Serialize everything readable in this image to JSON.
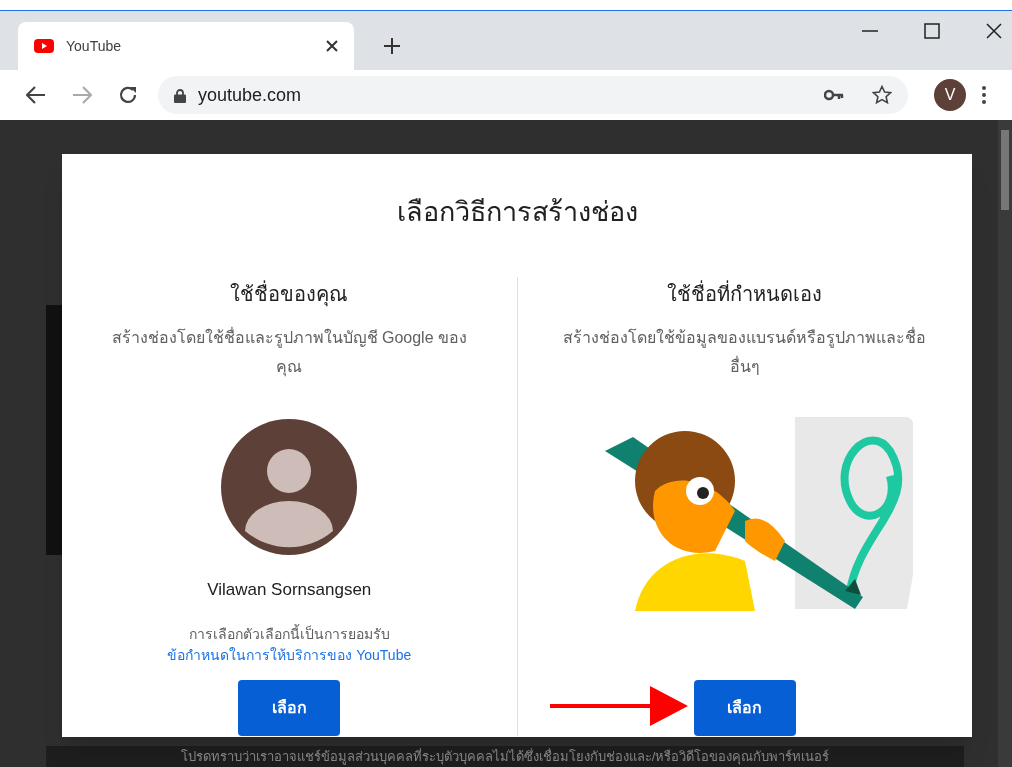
{
  "browser": {
    "tab": {
      "title": "YouTube",
      "selected": true
    },
    "address": "youtube.com",
    "profile_initial": "V"
  },
  "dialog": {
    "title": "เลือกวิธีการสร้างช่อง",
    "options": [
      {
        "kind": "account",
        "heading": "ใช้ชื่อของคุณ",
        "description": "สร้างช่องโดยใช้ชื่อและรูปภาพในบัญชี Google ของคุณ",
        "account_name": "Vilawan Sornsangsen",
        "terms_note": "การเลือกตัวเลือกนี้เป็นการยอมรับ",
        "terms_link": "ข้อกำหนดในการให้บริการของ YouTube",
        "button": "เลือก",
        "pointed": false
      },
      {
        "kind": "custom",
        "heading": "ใช้ชื่อที่กำหนดเอง",
        "description": "สร้างช่องโดยใช้ข้อมูลของแบรนด์หรือรูปภาพและชื่ออื่นๆ",
        "button": "เลือก",
        "pointed": true
      }
    ]
  },
  "background_notice": "โปรดทราบว่าเราอาจแชร์ข้อมูลส่วนบุคคลที่ระบุตัวบุคคลไม่ได้ซึ่งเชื่อมโยงกับช่องและ/หรือวิดีโอของคุณกับพาร์ทเนอร์"
}
